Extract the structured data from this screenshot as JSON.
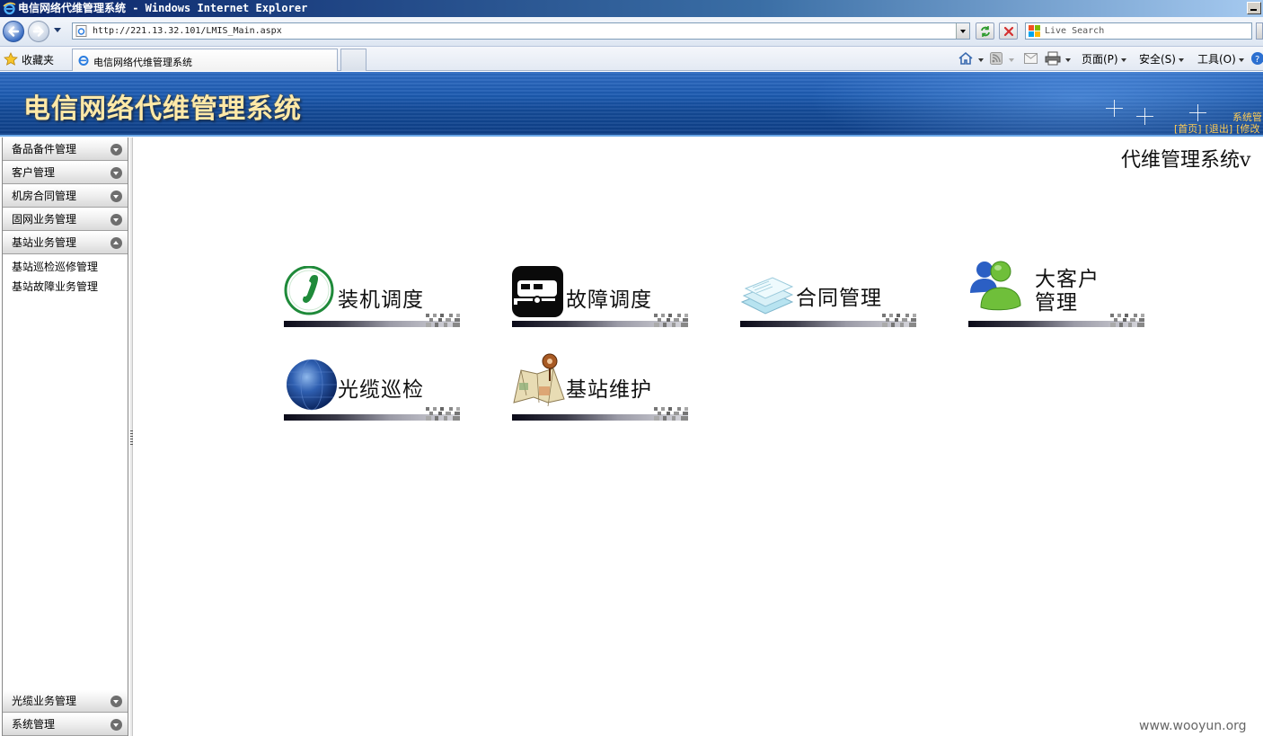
{
  "window": {
    "title": "电信网络代维管理系统 - Windows Internet Explorer"
  },
  "browser": {
    "url": "http://221.13.32.101/LMIS_Main.aspx",
    "search_placeholder": "Live Search",
    "favorites_label": "收藏夹",
    "tab_title": "电信网络代维管理系统",
    "commands": {
      "page": "页面(P)",
      "safety": "安全(S)",
      "tools": "工具(O)"
    }
  },
  "banner": {
    "title": "电信网络代维管理系统",
    "sys_text": "系统管",
    "links": [
      "[首页]",
      "[退出]",
      "[修改"
    ]
  },
  "sidebar": {
    "top_sections": [
      {
        "label": "备品备件管理",
        "expanded": false
      },
      {
        "label": "客户管理",
        "expanded": false
      },
      {
        "label": "机房合同管理",
        "expanded": false
      },
      {
        "label": "固网业务管理",
        "expanded": false
      },
      {
        "label": "基站业务管理",
        "expanded": true
      }
    ],
    "sub_items": [
      "基站巡检巡修管理",
      "基站故障业务管理"
    ],
    "bottom_sections": [
      {
        "label": "光缆业务管理",
        "expanded": false
      },
      {
        "label": "系统管理",
        "expanded": false
      }
    ]
  },
  "main": {
    "title": "代维管理系统v",
    "tiles": [
      {
        "label": "装机调度",
        "icon": "phone-icon"
      },
      {
        "label": "故障调度",
        "icon": "vehicle-icon"
      },
      {
        "label": "合同管理",
        "icon": "documents-icon"
      },
      {
        "label": "大客户\n管理",
        "line1": "大客户",
        "line2": "管理",
        "icon": "users-icon"
      },
      {
        "label": "光缆巡检",
        "icon": "globe-icon"
      },
      {
        "label": "基站维护",
        "icon": "map-pin-icon"
      }
    ]
  },
  "watermark": "www.wooyun.org",
  "colors": {
    "banner_blue": "#1d5bb1",
    "banner_title": "#ffe9a8",
    "banner_link": "#ffcc55"
  }
}
